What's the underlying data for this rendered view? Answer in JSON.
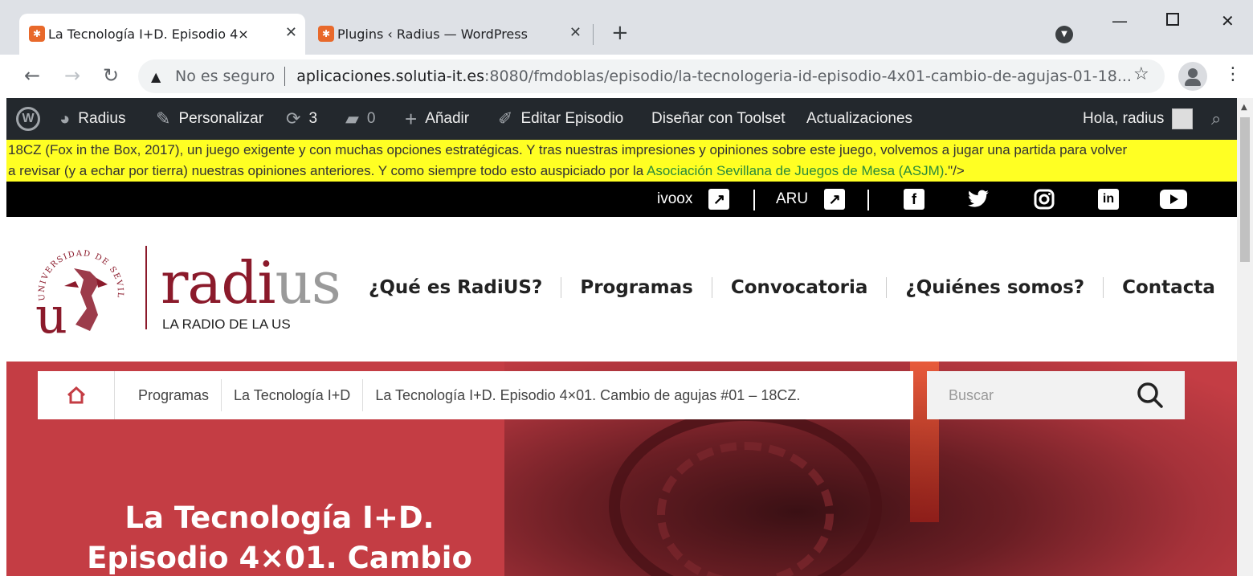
{
  "browser": {
    "tabs": [
      {
        "title": "La Tecnología I+D. Episodio 4×",
        "close": "✕"
      },
      {
        "title": "Plugins ‹ Radius — WordPress",
        "close": "✕"
      }
    ],
    "new_tab": "+",
    "address": {
      "warning": "No es seguro",
      "host": "aplicaciones.solutia-it.es",
      "path": ":8080/fmdoblas/episodio/la-tecnologeria-id-episodio-4x01-cambio-de-agujas-01-18..."
    }
  },
  "wp_admin_bar": {
    "site": "Radius",
    "customize": "Personalizar",
    "updates_count": "3",
    "comments_count": "0",
    "add_new": "Añadir",
    "edit": "Editar Episodio",
    "toolset": "Diseñar con Toolset",
    "updates": "Actualizaciones",
    "greeting": "Hola, radius"
  },
  "highlight": {
    "line1": "18CZ (Fox in the Box, 2017), un juego exigente y con muchas opciones estratégicas. Y tras nuestras impresiones y opiniones sobre este juego, volvemos a jugar una partida para volver",
    "line2_prefix": "a revisar (y a echar por tierra) nuestras opiniones anteriores. Y como siempre todo esto auspiciado por la ",
    "link": "Asociación Sevillana de Juegos de Mesa (ASJM)",
    "suffix": ".\"/>"
  },
  "social": {
    "ivoox": "ivoox",
    "aru": "ARU",
    "icons": [
      "facebook-icon",
      "twitter-icon",
      "instagram-icon",
      "linkedin-icon",
      "youtube-icon"
    ]
  },
  "header": {
    "logo_main": "radi",
    "logo_suffix": "us",
    "tagline": "LA RADIO DE LA US",
    "seal_text": "UNIVERSIDAD DE SEVILLA",
    "nav": [
      "¿Qué es RadiUS?",
      "Programas",
      "Convocatoria",
      "¿Quiénes somos?",
      "Contacta"
    ]
  },
  "breadcrumb": {
    "items": [
      "Programas",
      "La Tecnología I+D",
      "La Tecnología I+D. Episodio 4×01. Cambio de agujas #01 – 18CZ."
    ]
  },
  "search": {
    "placeholder": "Buscar"
  },
  "hero": {
    "title_line1": "La Tecnología I+D.",
    "title_line2": "Episodio 4×01. Cambio"
  },
  "colors": {
    "brand": "#8b1a2b",
    "hero_bg": "#c43d44",
    "highlight": "#ffff23",
    "wp_bar": "#23282d"
  }
}
